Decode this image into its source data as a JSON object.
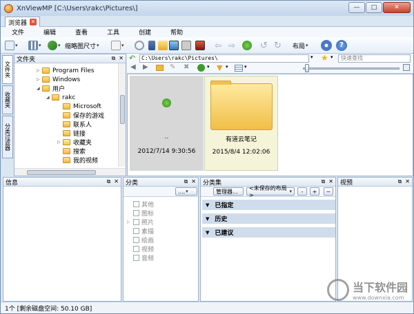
{
  "window": {
    "title": "XnViewMP [C:\\Users\\rakc\\Pictures\\]",
    "min": "—",
    "max": "□",
    "close": "✕"
  },
  "tab": {
    "label": "浏览器"
  },
  "menu": [
    "文件",
    "编辑",
    "查看",
    "工具",
    "创建",
    "帮助"
  ],
  "toolbar": {
    "thumb_size": "缩略图尺寸",
    "layout": "布局"
  },
  "sidetabs": [
    "文件夹",
    "收藏夹",
    "分类过滤器"
  ],
  "folder_pane": {
    "title": "文件夹",
    "tree": [
      {
        "label": "Program Files",
        "level": 1,
        "expander": "▷"
      },
      {
        "label": "Windows",
        "level": 1,
        "expander": "▷"
      },
      {
        "label": "用户",
        "level": 1,
        "expander": "◢"
      },
      {
        "label": "rakc",
        "level": 2,
        "expander": "◢"
      },
      {
        "label": "Microsoft",
        "level": 3,
        "expander": ""
      },
      {
        "label": "保存的游戏",
        "level": 3,
        "expander": ""
      },
      {
        "label": "联系人",
        "level": 3,
        "expander": ""
      },
      {
        "label": "链接",
        "level": 3,
        "expander": ""
      },
      {
        "label": "收藏夹",
        "level": 3,
        "expander": "▷"
      },
      {
        "label": "搜索",
        "level": 3,
        "expander": ""
      },
      {
        "label": "我的视频",
        "level": 3,
        "expander": ""
      }
    ]
  },
  "address": {
    "path": "C:\\Users\\rakc\\Pictures\\",
    "search_placeholder": "快速查找"
  },
  "thumbs": [
    {
      "name": "..",
      "date": "2012/7/14 9:30:56"
    },
    {
      "name": "有道云笔记",
      "date": "2015/8/4 12:02:06"
    }
  ],
  "panels": {
    "info": "信息",
    "category": "分类",
    "category_set": "分类集",
    "preview": "视预",
    "pane_btns": [
      "⧉",
      "✕"
    ]
  },
  "category": {
    "dropdown": "....",
    "items": [
      "其他",
      "图标",
      "照片",
      "素描",
      "绘画",
      "视频",
      "音频"
    ]
  },
  "category_set": {
    "manager": "管理器...",
    "layout": "<未保存的布局>",
    "minus": "-",
    "plus": "+",
    "tilde": "~",
    "rows": [
      "已指定",
      "历史",
      "已建议"
    ]
  },
  "status": "1个 [剩余磁盘空间: 50.10 GB]",
  "watermark": {
    "text": "当下软件园",
    "url": "www.downxia.com"
  }
}
